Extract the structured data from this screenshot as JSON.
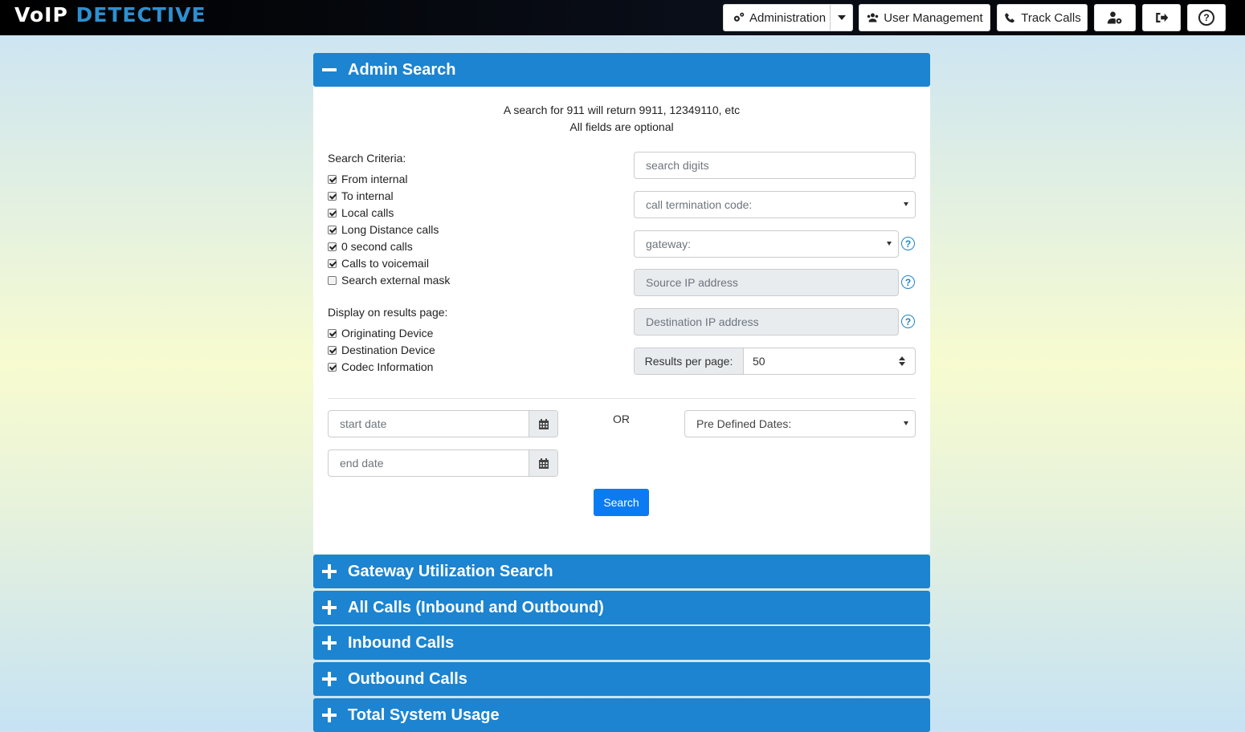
{
  "app": {
    "logo_part1": "VoIP",
    "logo_part2": "DETECTIVE"
  },
  "nav": {
    "administration": "Administration",
    "user_management": "User Management",
    "track_calls": "Track Calls",
    "icons": [
      "user-settings-icon",
      "logout-icon",
      "help-icon"
    ]
  },
  "admin_search": {
    "title": "Admin Search",
    "info_line1": "A search for 911 will return 9911, 12349110, etc",
    "info_line2": "All fields are optional",
    "criteria_label": "Search Criteria:",
    "criteria": [
      {
        "label": "From internal",
        "checked": true
      },
      {
        "label": "To internal",
        "checked": true
      },
      {
        "label": "Local calls",
        "checked": true
      },
      {
        "label": "Long Distance calls",
        "checked": true
      },
      {
        "label": "0 second calls",
        "checked": true
      },
      {
        "label": "Calls to voicemail",
        "checked": true
      },
      {
        "label": "Search external mask",
        "checked": false
      }
    ],
    "display_label": "Display on results page:",
    "display": [
      {
        "label": "Originating Device",
        "checked": true
      },
      {
        "label": "Destination Device",
        "checked": true
      },
      {
        "label": "Codec Information",
        "checked": true
      }
    ],
    "search_digits_placeholder": "search digits",
    "termination_code": "call termination code:",
    "gateway": "gateway:",
    "source_ip_placeholder": "Source IP address",
    "dest_ip_placeholder": "Destination IP address",
    "results_per_page_label": "Results per page:",
    "results_per_page_value": "50",
    "start_date_placeholder": "start date",
    "end_date_placeholder": "end date",
    "or_label": "OR",
    "predefined_dates": "Pre Defined Dates:",
    "search_button": "Search"
  },
  "accordion": [
    "Gateway Utilization Search",
    "All Calls (Inbound and Outbound)",
    "Inbound Calls",
    "Outbound Calls",
    "Total System Usage"
  ],
  "colors": {
    "accent": "#1c84d0",
    "button": "#0a7bf2"
  }
}
